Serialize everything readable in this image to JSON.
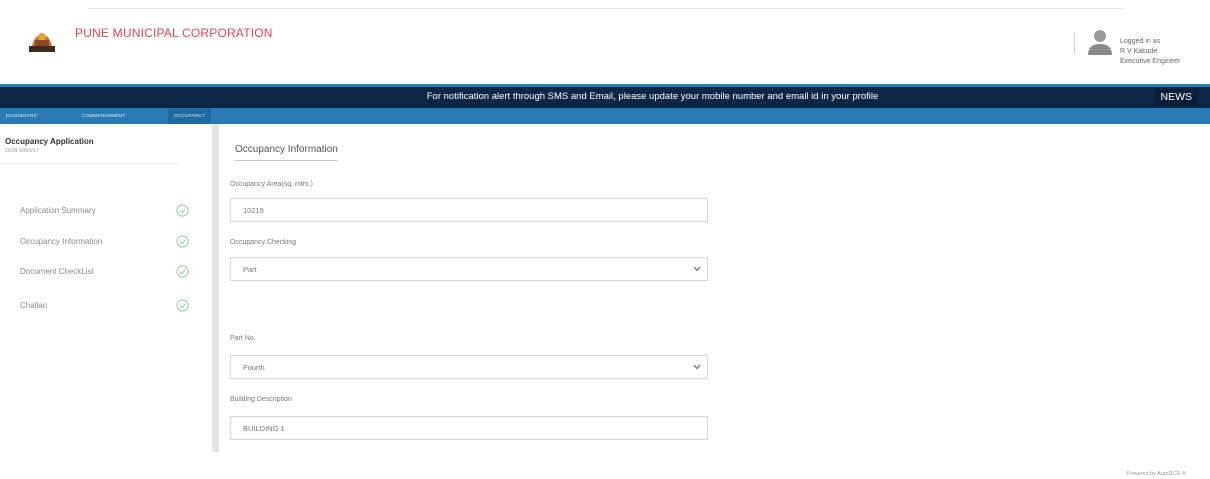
{
  "header": {
    "brand": "PUNE MUNICIPAL CORPORATION",
    "user_logged_label": "Logged in as",
    "user_name": "R V Kakade",
    "user_role": "Executive Engineer"
  },
  "notification": {
    "text": "For notification alert through SMS and Email, please update your mobile number and email id in your profile",
    "news_label": "NEWS"
  },
  "tabs": [
    {
      "label": "DASHBOARD"
    },
    {
      "label": "COMMENCEMENT"
    },
    {
      "label": "OCCUPANCY"
    }
  ],
  "sidebar": {
    "title": "Occupancy Application",
    "subtitle": "OCN-5999/17",
    "items": [
      {
        "label": "Application Summary"
      },
      {
        "label": "Occupancy Information"
      },
      {
        "label": "Document CheckList"
      },
      {
        "label": "Challan"
      }
    ]
  },
  "main": {
    "section_title": "Occupancy Information",
    "fields": [
      {
        "label": "Occupancy Area(sq. mtrs.)",
        "value": "10219"
      },
      {
        "label": "Occupancy Checking",
        "value": "Part"
      },
      {
        "label": "Part No.",
        "value": "Fourth"
      },
      {
        "label": "Building Description",
        "value": "BUILDING 1"
      }
    ]
  },
  "footer": {
    "text": "Powered by AutoDCR ®"
  },
  "colors": {
    "brand": "#d9484e",
    "notif_bg": "#0c2746",
    "tab_bar": "#2a7bb5",
    "check": "#8fd18f"
  },
  "icons": [
    "logo-icon",
    "user-avatar-icon",
    "check-circle-icon",
    "chevron-down-icon"
  ]
}
